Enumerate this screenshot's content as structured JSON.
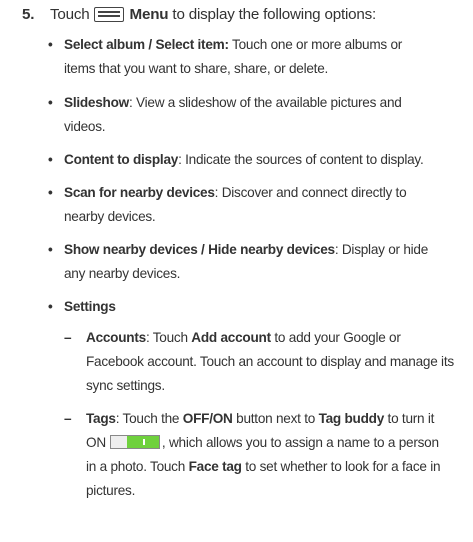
{
  "step": {
    "number": "5.",
    "pre": "Touch",
    "icon": "menu-icon",
    "menu_label": "Menu",
    "post": "to display the following options:"
  },
  "items": [
    {
      "title": "Select album / Select item:",
      "text": " Touch one or more albums or",
      "text2": "items that you want to share, share, or delete."
    },
    {
      "title": "Slideshow",
      "text": ": View a slideshow of the available pictures and",
      "text2": "videos."
    },
    {
      "title": "Content to display",
      "text": ": Indicate the sources of content to display."
    },
    {
      "title": "Scan for nearby devices",
      "text": ": Discover and connect directly to",
      "text2": "nearby devices."
    },
    {
      "title": "Show nearby devices / Hide nearby devices",
      "text": ": Display or hide",
      "text2": "any nearby devices."
    },
    {
      "title": "Settings"
    }
  ],
  "settings": {
    "accounts": {
      "title": "Accounts",
      "t1": ": Touch ",
      "add": "Add account",
      "t2": " to add your Google or",
      "line2": "Facebook account. Touch an account to display and manage its",
      "line3": "sync settings."
    },
    "tags": {
      "title": "Tags",
      "t1": ": Touch the ",
      "offon": "OFF/ON",
      "t2": " button next to ",
      "buddy": "Tag buddy",
      "t3": " to turn it",
      "on": "ON",
      "t4": ", which allows you to assign a name to a person",
      "line3a": "in a photo. Touch ",
      "face": "Face tag",
      "line3b": " to set whether to look for a face in",
      "line4": "pictures."
    },
    "toggle_color": "#6fd13d"
  }
}
